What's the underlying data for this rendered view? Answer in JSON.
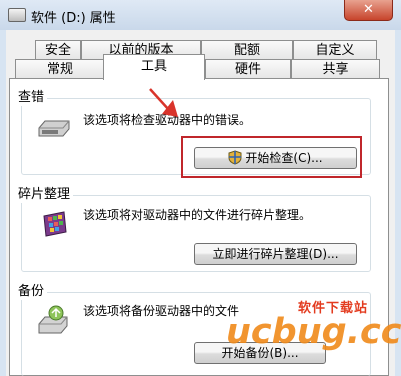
{
  "window": {
    "title": "软件 (D:) 属性",
    "close_glyph": "✕"
  },
  "tabs_row1": [
    "安全",
    "以前的版本",
    "配额",
    "自定义"
  ],
  "tabs_row2": [
    "常规",
    "工具",
    "硬件",
    "共享"
  ],
  "sections": {
    "check": {
      "title": "查错",
      "description": "该选项将检查驱动器中的错误。",
      "button": "开始检查(C)..."
    },
    "defrag": {
      "title": "碎片整理",
      "description": "该选项将对驱动器中的文件进行碎片整理。",
      "button": "立即进行碎片整理(D)..."
    },
    "backup": {
      "title": "备份",
      "description": "该选项将备份驱动器中的文件",
      "button": "开始备份(B)..."
    }
  },
  "watermark": {
    "logo": "ucbug.cc",
    "tagline": "软件下载站"
  },
  "colors": {
    "highlight_box": "#c0262b",
    "arrow": "#d9342b"
  }
}
